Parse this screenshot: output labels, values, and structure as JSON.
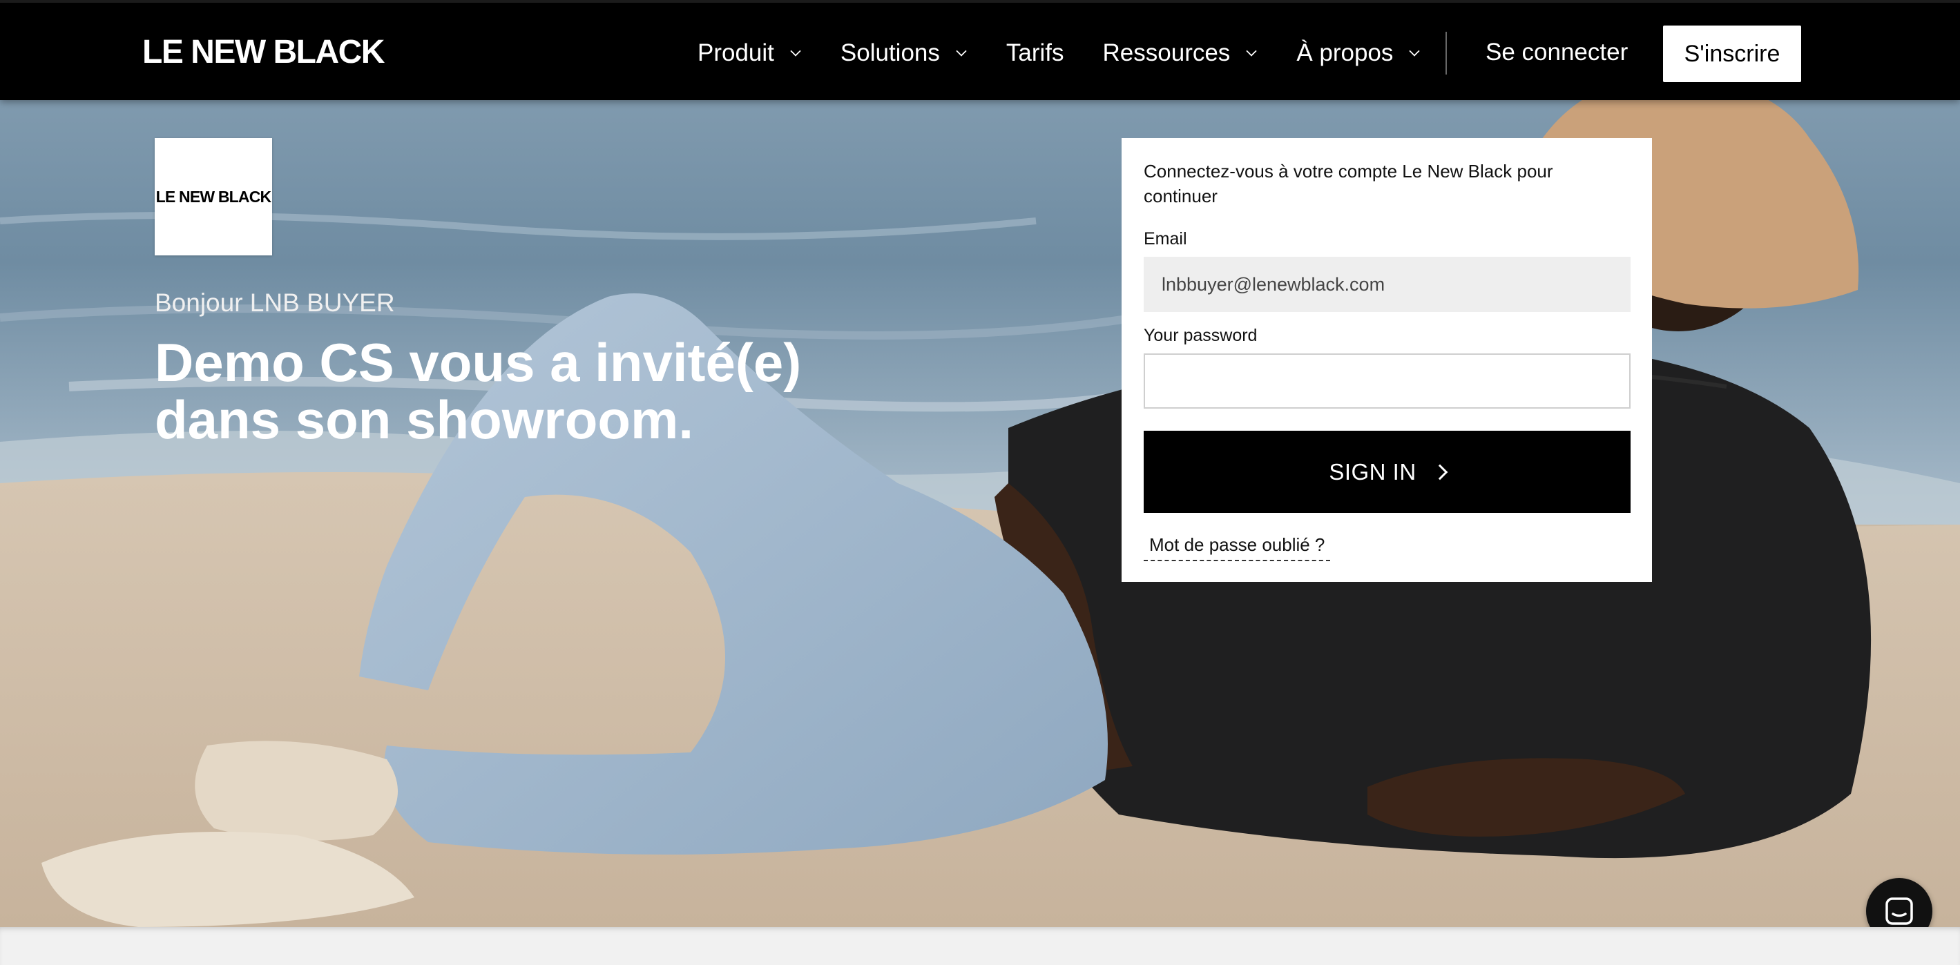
{
  "nav": {
    "brand": "LE NEW BLACK",
    "items": [
      {
        "label": "Produit",
        "has_dropdown": true
      },
      {
        "label": "Solutions",
        "has_dropdown": true
      },
      {
        "label": "Tarifs",
        "has_dropdown": false
      },
      {
        "label": "Ressources",
        "has_dropdown": true
      },
      {
        "label": "À propos",
        "has_dropdown": true
      }
    ],
    "login_label": "Se connecter",
    "signup_label": "S'inscrire"
  },
  "hero": {
    "logo_text": "LE NEW BLACK",
    "greeting": "Bonjour LNB BUYER",
    "headline_line1": "Demo CS vous a invité(e)",
    "headline_line2": "dans son showroom."
  },
  "login_card": {
    "intro": "Connectez-vous à votre compte Le New Black pour continuer",
    "email_label": "Email",
    "email_value": "lnbbuyer@lenewblack.com",
    "password_label": "Your password",
    "password_value": "",
    "submit_label": "SIGN IN",
    "forgot_label": "Mot de passe oublié ?"
  },
  "icons": {
    "nav_dropdown": "chevron-down-icon",
    "submit_arrow": "chevron-right-icon",
    "chat": "chat-bubble-icon"
  },
  "colors": {
    "nav_background": "#000000",
    "primary_button": "#000000",
    "input_background": "#eeeeee"
  }
}
